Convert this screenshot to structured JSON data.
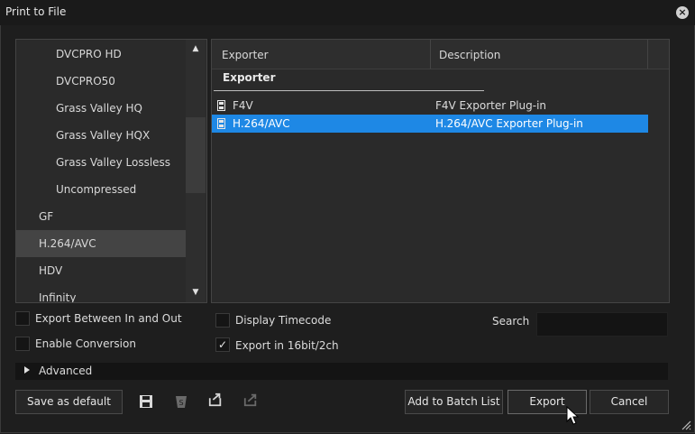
{
  "window": {
    "title": "Print to File"
  },
  "left_list": {
    "items": [
      {
        "label": "DVCPRO HD",
        "level": "child"
      },
      {
        "label": "DVCPRO50",
        "level": "child"
      },
      {
        "label": "Grass Valley HQ",
        "level": "child"
      },
      {
        "label": "Grass Valley HQX",
        "level": "child"
      },
      {
        "label": "Grass Valley Lossless",
        "level": "child"
      },
      {
        "label": "Uncompressed",
        "level": "child"
      },
      {
        "label": "GF",
        "level": "top"
      },
      {
        "label": "H.264/AVC",
        "level": "top",
        "selected": true
      },
      {
        "label": "HDV",
        "level": "top"
      },
      {
        "label": "Infinity",
        "level": "top"
      }
    ]
  },
  "exporter_table": {
    "columns": [
      "Exporter",
      "Description"
    ],
    "group": "Exporter",
    "rows": [
      {
        "name": "F4V",
        "description": "F4V Exporter Plug-in",
        "selected": false
      },
      {
        "name": "H.264/AVC",
        "description": "H.264/AVC Exporter Plug-in",
        "selected": true
      }
    ]
  },
  "options": {
    "export_between": {
      "label": "Export Between In and Out",
      "checked": false
    },
    "enable_conversion": {
      "label": "Enable Conversion",
      "checked": false
    },
    "display_timecode": {
      "label": "Display Timecode",
      "checked": false
    },
    "export_16bit": {
      "label": "Export in 16bit/2ch",
      "checked": true,
      "mark": "✓"
    }
  },
  "search": {
    "label": "Search",
    "value": ""
  },
  "advanced": {
    "label": "Advanced"
  },
  "buttons": {
    "save_default": "Save as default",
    "add_batch": "Add to Batch List",
    "export": "Export",
    "cancel": "Cancel"
  },
  "icons": {
    "save": "save-icon",
    "delete": "delete-preset-icon",
    "import": "import-preset-icon",
    "export_preset": "export-preset-icon"
  },
  "colors": {
    "selection": "#1e88e5",
    "background": "#1e1e1e"
  }
}
